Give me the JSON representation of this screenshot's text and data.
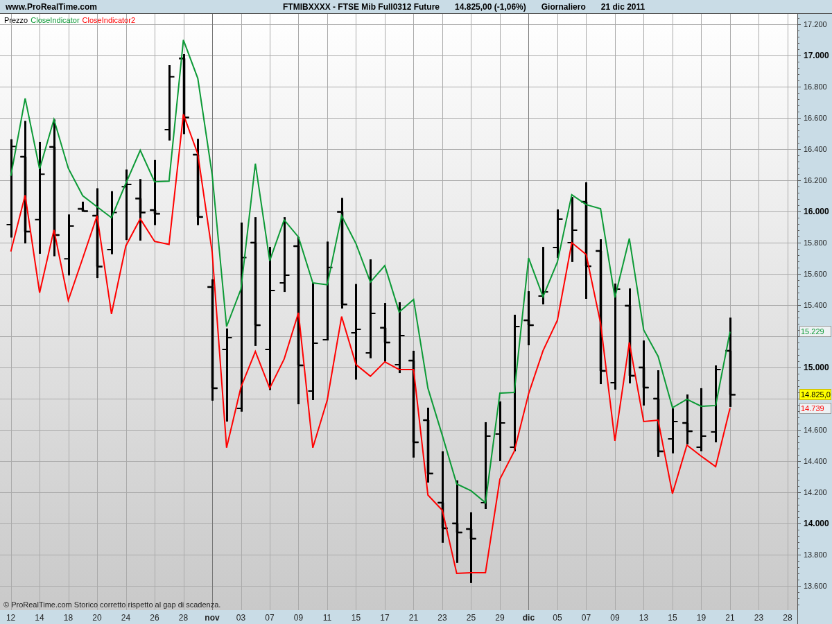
{
  "header": {
    "site": "www.ProRealTime.com",
    "instrument": "FTMIBXXXX - FTSE Mib Full0312 Future",
    "quote": "14.825,00 (-1,06%)",
    "period": "Giornaliero",
    "date": "21 dic 2011"
  },
  "chart": {
    "chart_data": {
      "type": "candlestick",
      "categories": [
        "12",
        null,
        "14",
        null,
        "18",
        null,
        "20",
        null,
        "24",
        null,
        "26",
        null,
        "28",
        null,
        "nov",
        null,
        "03",
        null,
        "07",
        null,
        "09",
        null,
        "11",
        null,
        "15",
        null,
        "17",
        null,
        "21",
        null,
        "23",
        null,
        "25",
        null,
        "29",
        null,
        "dic",
        null,
        "05",
        null,
        "07",
        null,
        "09",
        null,
        "13",
        null,
        "15",
        null,
        "19",
        null,
        "21",
        null,
        "23",
        null,
        "28"
      ],
      "ylim": [
        13444,
        17267
      ],
      "grid": true,
      "series": [
        {
          "name": "Prezzo",
          "color": "#000000",
          "ohlc": [
            [
              15915,
              16463,
              15833,
              16417
            ],
            [
              16351,
              16581,
              15795,
              15871
            ],
            [
              15948,
              16445,
              15729,
              16239
            ],
            [
              16414,
              16590,
              15713,
              15849
            ],
            [
              15697,
              15981,
              15590,
              15907
            ],
            [
              16017,
              16063,
              15998,
              16002
            ],
            [
              15973,
              16149,
              15573,
              15647
            ],
            [
              15756,
              16130,
              15726,
              15994
            ],
            [
              16159,
              16269,
              15817,
              16174
            ],
            [
              16083,
              16208,
              15813,
              15994
            ],
            [
              16009,
              16330,
              15912,
              15986
            ],
            [
              16524,
              16938,
              16455,
              16864
            ],
            [
              16981,
              17009,
              16496,
              16603
            ],
            [
              16364,
              16466,
              15912,
              15965
            ],
            [
              15516,
              15565,
              14787,
              14867
            ],
            [
              15116,
              15250,
              14653,
              15191
            ],
            [
              14738,
              15929,
              14716,
              15704
            ],
            [
              15800,
              15964,
              15138,
              15271
            ],
            [
              15116,
              15773,
              14855,
              15493
            ],
            [
              15542,
              15964,
              15484,
              15591
            ],
            [
              15778,
              15836,
              14764,
              15013
            ],
            [
              14849,
              15542,
              14791,
              15156
            ],
            [
              15178,
              15807,
              15173,
              15641
            ],
            [
              15998,
              16087,
              15378,
              15404
            ],
            [
              15222,
              15535,
              14922,
              15244
            ],
            [
              15093,
              15693,
              15059,
              15347
            ],
            [
              15254,
              15413,
              15037,
              15160
            ],
            [
              15018,
              15418,
              14964,
              15204
            ],
            [
              15044,
              15107,
              14422,
              14520
            ],
            [
              14662,
              14742,
              14262,
              14320
            ],
            [
              14133,
              14462,
              13876,
              13969
            ],
            [
              14000,
              14276,
              13747,
              13942
            ],
            [
              13964,
              14071,
              13618,
              13902
            ],
            [
              14133,
              14649,
              14093,
              14560
            ],
            [
              14573,
              14782,
              14400,
              14644
            ],
            [
              14489,
              15338,
              14462,
              15262
            ],
            [
              15302,
              15489,
              15142,
              15271
            ],
            [
              15458,
              15773,
              15404,
              15484
            ],
            [
              15769,
              16013,
              15702,
              15951
            ],
            [
              15800,
              16093,
              15676,
              15880
            ],
            [
              16062,
              16187,
              15440,
              15649
            ],
            [
              15747,
              15822,
              14893,
              14978
            ],
            [
              14902,
              15538,
              14858,
              15502
            ],
            [
              15396,
              15507,
              14898,
              14947
            ],
            [
              15000,
              15173,
              14756,
              14871
            ],
            [
              14800,
              14982,
              14427,
              14462
            ],
            [
              14542,
              14738,
              14449,
              14653
            ],
            [
              14644,
              14827,
              14507,
              14591
            ],
            [
              14489,
              14867,
              14462,
              14560
            ],
            [
              14587,
              15013,
              14520,
              14987
            ],
            [
              15107,
              15320,
              14747,
              14825
            ],
            null,
            null,
            null,
            null
          ]
        },
        {
          "name": "CloseIndicator",
          "type": "line",
          "color": "#0c9a36",
          "values": [
            16228,
            16725,
            16272,
            16590,
            16277,
            16101,
            16030,
            15960,
            16180,
            16392,
            16190,
            16195,
            17100,
            16853,
            16236,
            15262,
            15502,
            16307,
            15684,
            15946,
            15836,
            15542,
            15530,
            15973,
            15793,
            15547,
            15653,
            15356,
            15436,
            14867,
            14564,
            14253,
            14209,
            14133,
            14836,
            14840,
            15702,
            15453,
            15676,
            16107,
            16044,
            16018,
            15449,
            15827,
            15240,
            15071,
            14742,
            14796,
            14751,
            14756,
            15229,
            null,
            null,
            null,
            null
          ]
        },
        {
          "name": "CloseIndicator2",
          "type": "line",
          "color": "#ff0000",
          "values": [
            15743,
            16104,
            15479,
            15882,
            15430,
            15700,
            15973,
            15343,
            15779,
            15953,
            15808,
            15789,
            16623,
            16368,
            15740,
            14485,
            14873,
            15102,
            14867,
            15053,
            15351,
            14485,
            14791,
            15326,
            15018,
            14944,
            15036,
            14987,
            14987,
            14182,
            14084,
            13680,
            13684,
            13684,
            14284,
            14462,
            14831,
            15107,
            15302,
            15800,
            15724,
            15284,
            14529,
            15160,
            14653,
            14662,
            14191,
            14502,
            14431,
            14364,
            14739,
            null,
            null,
            null,
            null
          ]
        }
      ],
      "yticks": [
        {
          "value": 13600,
          "label": "13.600"
        },
        {
          "value": 13800,
          "label": "13.800"
        },
        {
          "value": 14000,
          "label": "14.000"
        },
        {
          "value": 14200,
          "label": "14.200"
        },
        {
          "value": 14400,
          "label": "14.400"
        },
        {
          "value": 14600,
          "label": "14.600"
        },
        {
          "value": 15000,
          "label": "15.000"
        },
        {
          "value": 15400,
          "label": "15.400"
        },
        {
          "value": 15600,
          "label": "15.600"
        },
        {
          "value": 15800,
          "label": "15.800"
        },
        {
          "value": 16000,
          "label": "16.000"
        },
        {
          "value": 16200,
          "label": "16.200"
        },
        {
          "value": 16400,
          "label": "16.400"
        },
        {
          "value": 16600,
          "label": "16.600"
        },
        {
          "value": 16800,
          "label": "16.800"
        },
        {
          "value": 17000,
          "label": "17.000"
        },
        {
          "value": 17200,
          "label": "17.200"
        }
      ]
    },
    "price_labels": [
      "15.229",
      "14.825,0",
      "14.739"
    ],
    "footer": "© ProRealTime.com  Storico corretto rispetto al gap di scadenza."
  }
}
